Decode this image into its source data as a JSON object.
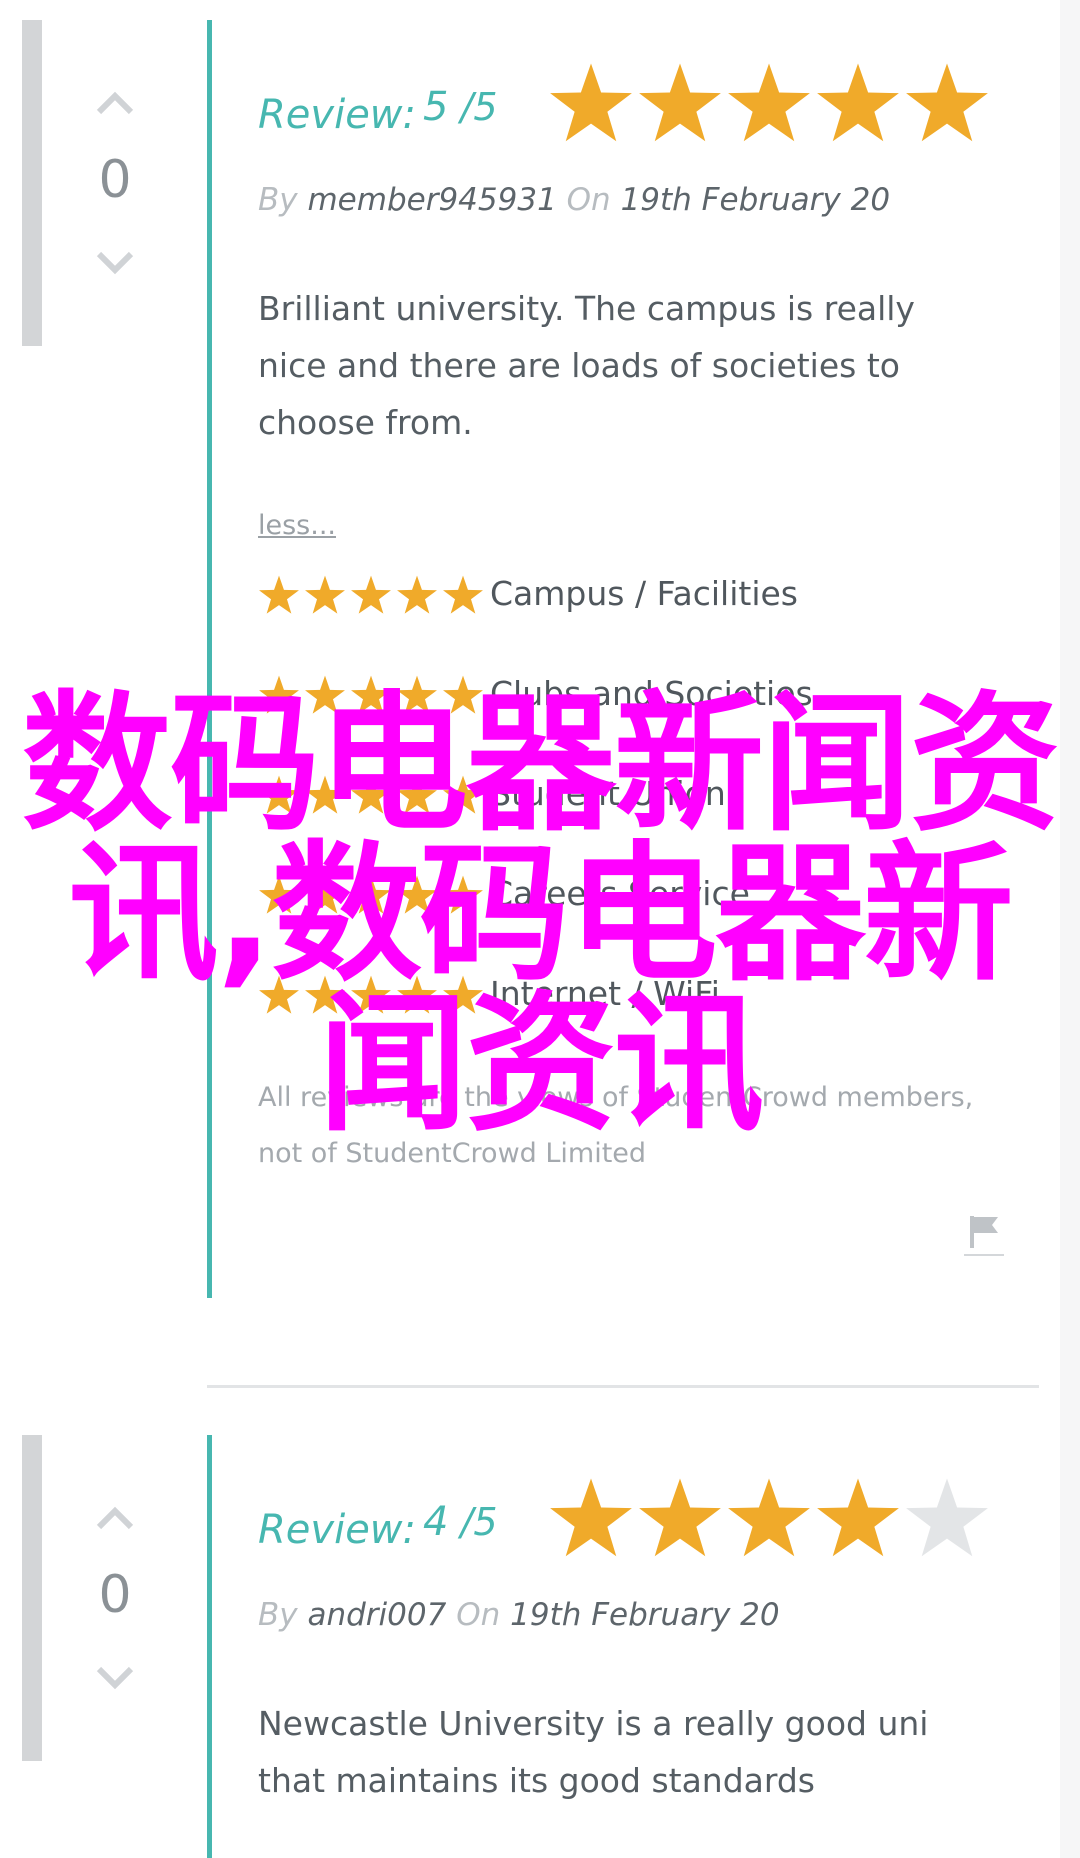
{
  "colors": {
    "accent": "#47b7b0",
    "star_filled": "#f0aa2a",
    "star_empty": "#e3e5e7",
    "overlay_text": "#ff00ff"
  },
  "reviews": [
    {
      "votes": "0",
      "review_label": "Review:",
      "score": "5",
      "score_total": "/5",
      "rating": 5,
      "by_label": "By",
      "author": "member945931",
      "on_label": "On",
      "date": "19th February 20",
      "text": "Brilliant university. The campus is really nice and there are loads of societies to choose from.",
      "less_label": "less...",
      "categories": [
        {
          "label": "Campus / Facilities",
          "rating": 5
        },
        {
          "label": "Clubs and Societies",
          "rating": 5
        },
        {
          "label": "Student Union",
          "rating": 5
        },
        {
          "label": "Careers Service",
          "rating": 5
        },
        {
          "label": "Internet / WiFi",
          "rating": 5
        }
      ],
      "disclaimer": "All reviews are the views of StudentCrowd members, not of StudentCrowd Limited",
      "icons": {
        "up": "chevron-up-icon",
        "down": "chevron-down-icon",
        "flag": "flag-icon"
      }
    },
    {
      "votes": "0",
      "review_label": "Review:",
      "score": "4",
      "score_total": "/5",
      "rating": 4,
      "by_label": "By",
      "author": "andri007",
      "on_label": "On",
      "date": "19th February 20",
      "text": "Newcastle University is a really good uni that maintains its good standards"
    }
  ],
  "overlay": {
    "line1": "数码电器新闻资",
    "line2": "讯,数码电器新",
    "line3": "闻资讯"
  }
}
